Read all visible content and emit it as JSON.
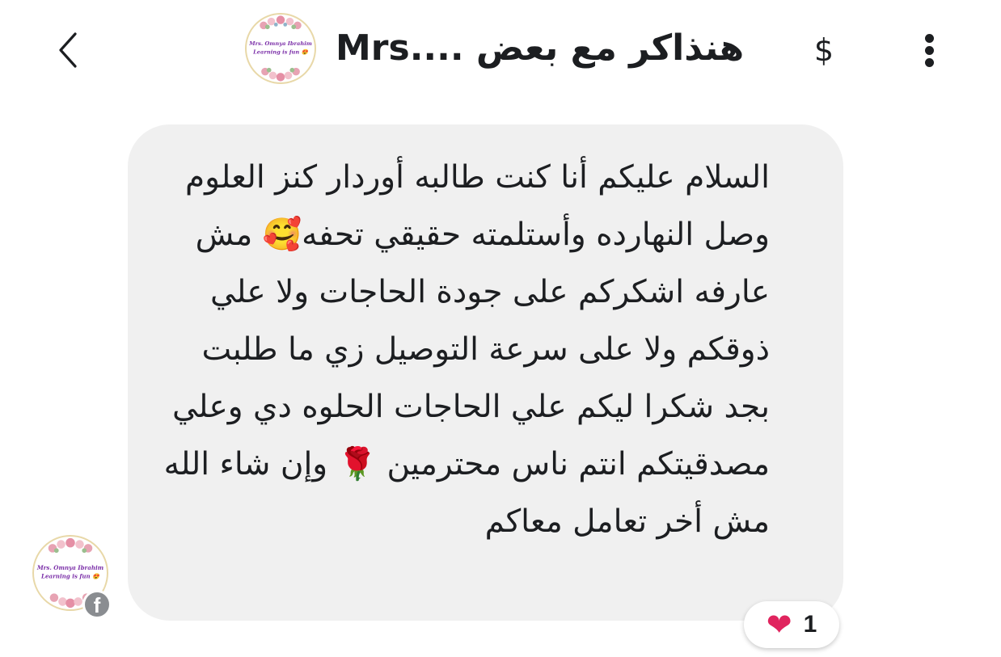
{
  "header": {
    "back_icon": "chevron-left-icon",
    "title": "هنذاكر مع بعض ....Mrs",
    "dollar_icon": "dollar-sign-icon",
    "dollar_label": "$",
    "more_icon": "vertical-ellipsis-icon",
    "avatar_logo_line1": "Mrs. Omnya Ibrahim",
    "avatar_logo_line2": "Learning is fun 😍"
  },
  "message": {
    "text": "السلام عليكم أنا كنت طالبه أوردار كنز العلوم وصل النهارده وأستلمته حقيقي تحفه🥰 مش عارفه اشكركم على جودة الحاجات ولا علي ذوقكم ولا على سرعة التوصيل زي ما طلبت بجد شكرا ليكم علي الحاجات الحلوه دي وعلي مصدقيتكم انتم ناس محترمين 🌹 وإن شاء الله مش أخر تعامل معاكم",
    "sender_logo_line1": "Mrs. Omnya Ibrahim",
    "sender_logo_line2": "Learning is fun 😍",
    "platform_badge": "f",
    "platform_icon": "facebook-icon",
    "reaction": {
      "icon": "heart-icon",
      "emoji": "❤",
      "count": "1"
    }
  },
  "colors": {
    "bubble_bg": "#f0f0f0",
    "text": "#1c1e21",
    "heart": "#e0245e",
    "fb_badge": "#8a8d91",
    "logo_text": "#7b2fa8"
  }
}
